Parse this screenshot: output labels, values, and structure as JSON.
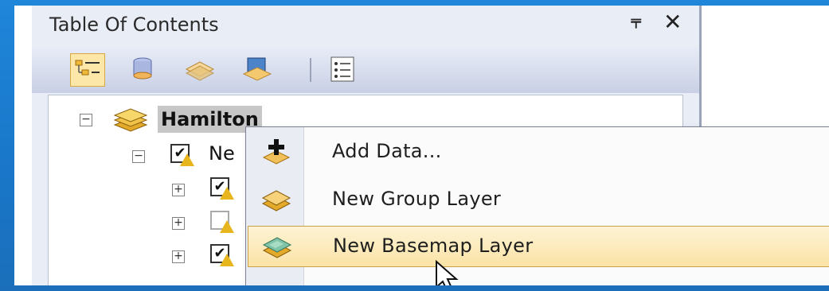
{
  "toc": {
    "title": "Table Of Contents",
    "pin_glyph": "⫧",
    "close_glyph": "✕",
    "toolbar": [
      "List By Drawing Order",
      "List By Source",
      "List By Visibility",
      "List By Selection",
      "Options"
    ]
  },
  "tree": {
    "root": {
      "label": "Hamilton",
      "expand_glyph": "−"
    },
    "child": {
      "label": "Ne",
      "expand_glyph": "−"
    },
    "rows": [
      {
        "expand_glyph": "+",
        "checked": true
      },
      {
        "expand_glyph": "+",
        "checked": false
      },
      {
        "expand_glyph": "+",
        "checked": true
      }
    ]
  },
  "context_menu": {
    "items": [
      {
        "label": "Add Data...",
        "icon": "add-data-icon"
      },
      {
        "label": "New Group Layer",
        "icon": "group-layer-icon"
      },
      {
        "label": "New Basemap Layer",
        "icon": "basemap-layer-icon",
        "highlighted": true
      }
    ]
  },
  "colors": {
    "background_blue": "#1f86d9",
    "highlight": "#fbe3a6",
    "warning": "#e7b51d"
  }
}
